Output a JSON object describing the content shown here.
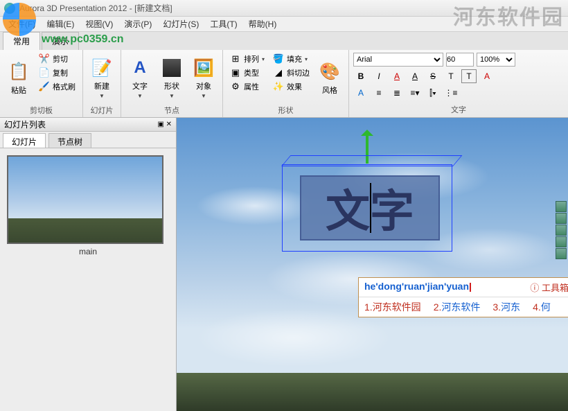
{
  "title": "Aurora 3D Presentation 2012 - [新建文档]",
  "watermark_text": "河东软件园",
  "watermark_url": "www.pc0359.cn",
  "menu": [
    "文件(F)",
    "编辑(E)",
    "视图(V)",
    "演示(P)",
    "幻灯片(S)",
    "工具(T)",
    "帮助(H)"
  ],
  "main_tabs": {
    "active": "常用",
    "inactive": "演示"
  },
  "ribbon": {
    "clipboard": {
      "label": "剪切板",
      "paste": "粘贴",
      "cut": "剪切",
      "copy": "复制",
      "format_painter": "格式刷"
    },
    "slides": {
      "label": "幻灯片",
      "new": "新建"
    },
    "nodes": {
      "label": "节点",
      "text": "文字",
      "shape": "形状",
      "object": "对象"
    },
    "shapes": {
      "label": "形状",
      "arrange": "排列",
      "type": "类型",
      "property": "属性",
      "fill": "填充",
      "bevel": "斜切边",
      "effect": "效果",
      "style": "风格"
    },
    "text_group_label": "文字"
  },
  "font": {
    "family": "Arial",
    "size": "60",
    "zoom": "100%"
  },
  "side_panel": {
    "title": "幻灯片列表",
    "tabs": {
      "slides": "幻灯片",
      "node_tree": "节点树"
    },
    "thumb_label": "main"
  },
  "scene_text": "文字",
  "ime": {
    "pinyin": "he'dong'ruan'jian'yuan",
    "toolbox_label": "工具箱",
    "candidates": [
      {
        "n": "1.",
        "t": "河东软件园"
      },
      {
        "n": "2.",
        "t": "河东软件"
      },
      {
        "n": "3.",
        "t": "河东"
      },
      {
        "n": "4.",
        "t": "何"
      }
    ]
  }
}
